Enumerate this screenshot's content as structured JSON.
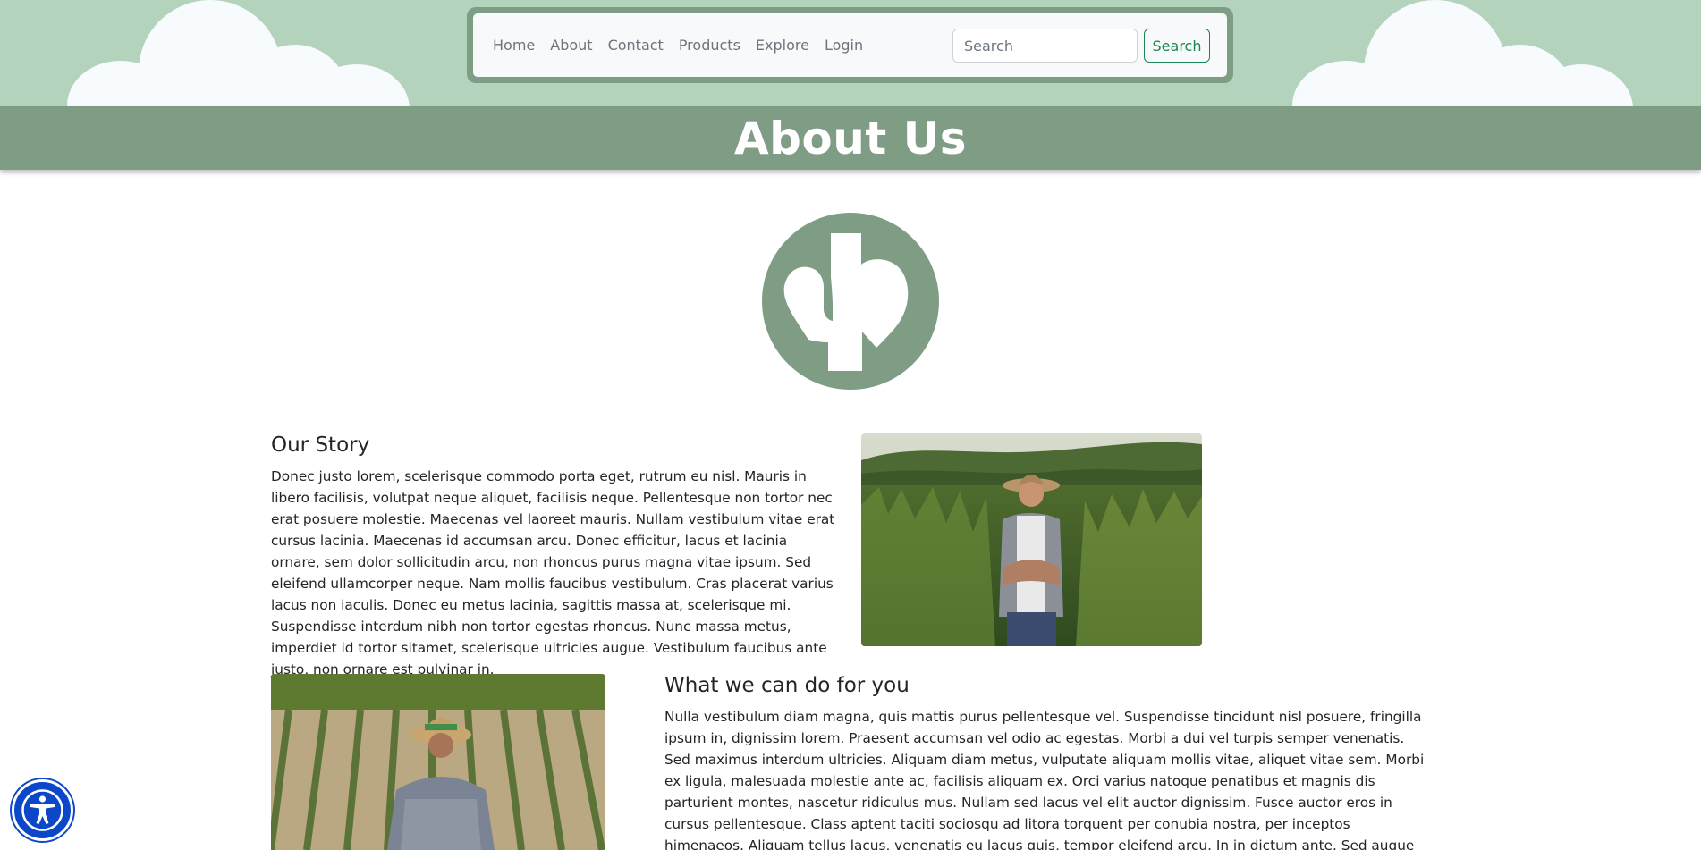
{
  "nav": {
    "links": [
      "Home",
      "About",
      "Contact",
      "Products",
      "Explore",
      "Login"
    ],
    "search_placeholder": "Search",
    "search_button": "Search"
  },
  "banner": {
    "title": "About Us"
  },
  "story": {
    "heading": "Our Story",
    "text": "Donec justo lorem, scelerisque commodo porta eget, rutrum eu nisl. Mauris in libero facilisis, volutpat neque aliquet, facilisis neque. Pellentesque non tortor nec erat posuere molestie. Maecenas vel laoreet mauris. Nullam vestibulum vitae erat cursus lacinia. Maecenas id accumsan arcu. Donec efficitur, lacus et lacinia ornare, sem dolor sollicitudin arcu, non rhoncus purus magna vitae ipsum. Sed eleifend ullamcorper neque. Nam mollis faucibus vestibulum. Cras placerat varius lacus non iaculis. Donec eu metus lacinia, sagittis massa at, scelerisque mi. Suspendisse interdum nibh non tortor egestas rhoncus. Nunc massa metus, imperdiet id tortor sitamet, scelerisque ultricies augue. Vestibulum faucibus ante justo, non ornare est pulvinar in."
  },
  "whatwedo": {
    "heading": "What we can do for you",
    "text": "Nulla vestibulum diam magna, quis mattis purus pellentesque vel. Suspendisse tincidunt nisl posuere, fringilla ipsum in, dignissim lorem. Praesent accumsan vel odio ac egestas. Morbi a dui vel turpis semper venenatis. Sed maximus interdum ultricies. Aliquam diam metus, vulputate aliquam mollis vitae, aliquet vitae sem. Morbi ex ligula, malesuada molestie ante ac, facilisis aliquam ex. Orci varius natoque penatibus et magnis dis parturient montes, nascetur ridiculus mus. Nullam sed lacus vel elit auctor dignissim. Fusce auctor eros in cursus pellentesque. Class aptent taciti sociosqu ad litora torquent per conubia nostra, per inceptos himenaeos. Aliquam tellus lacus, venenatis eu lacus quis, tempor eleifend arcu. In in dictum ante. Sed augue nunc, tempor cursus posuere ut, rutrum vitae lorem. Aenean sed mauris sed nisi dignissim gravida non"
  },
  "colors": {
    "sky": "#b4d3bd",
    "banner": "#7e9d84",
    "accent": "#198754",
    "accessibility": "#0d47c9"
  },
  "icons": {
    "logo": "company-logo",
    "accessibility": "accessibility-icon"
  }
}
